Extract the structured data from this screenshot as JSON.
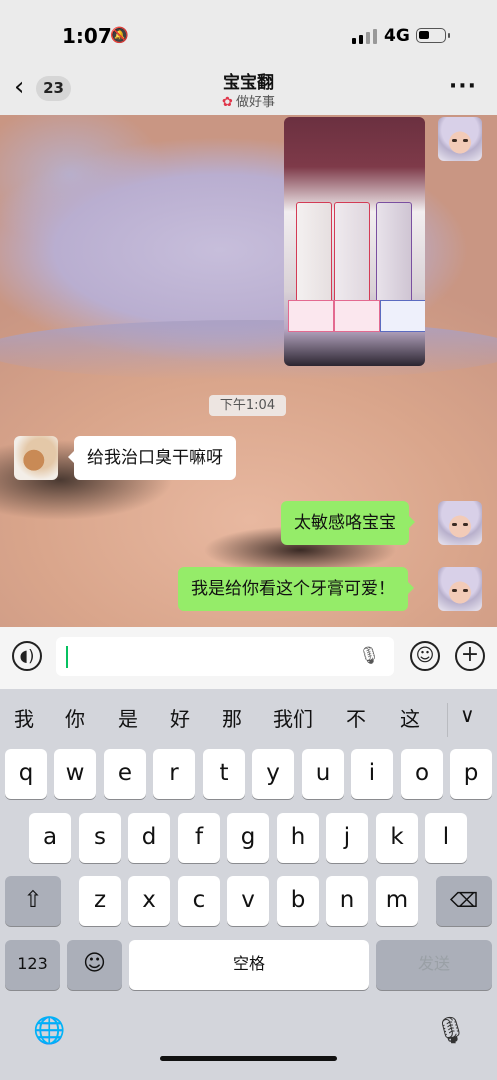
{
  "status": {
    "time": "1:07",
    "mute_icon": "bell-slash-icon",
    "network": "4G"
  },
  "nav": {
    "back_count": "23",
    "title": "宝宝翻",
    "subtitle": "做好事",
    "subtitle_icon": "flower-icon"
  },
  "messages": [
    {
      "side": "right",
      "type": "image",
      "content": "EUTHYMOL toothpaste photo"
    },
    {
      "type": "time",
      "text": "下午1:04"
    },
    {
      "side": "left",
      "type": "text",
      "text": "给我治口臭干嘛呀"
    },
    {
      "side": "right",
      "type": "text",
      "text": "太敏感咯宝宝"
    },
    {
      "side": "right",
      "type": "text",
      "text": "我是给你看这个牙膏可爱！"
    }
  ],
  "input": {
    "value": ""
  },
  "candidates": [
    "我",
    "你",
    "是",
    "好",
    "那",
    "我们",
    "不",
    "这"
  ],
  "keyboard": {
    "row1": [
      "q",
      "w",
      "e",
      "r",
      "t",
      "y",
      "u",
      "i",
      "o",
      "p"
    ],
    "row2": [
      "a",
      "s",
      "d",
      "f",
      "g",
      "h",
      "j",
      "k",
      "l"
    ],
    "row3": [
      "z",
      "x",
      "c",
      "v",
      "b",
      "n",
      "m"
    ],
    "num": "123",
    "space": "空格",
    "send": "发送"
  },
  "colors": {
    "outgoing_bubble": "#95ec69",
    "incoming_bubble": "#ffffff",
    "caret": "#07c160",
    "flower": "#e0364a"
  }
}
